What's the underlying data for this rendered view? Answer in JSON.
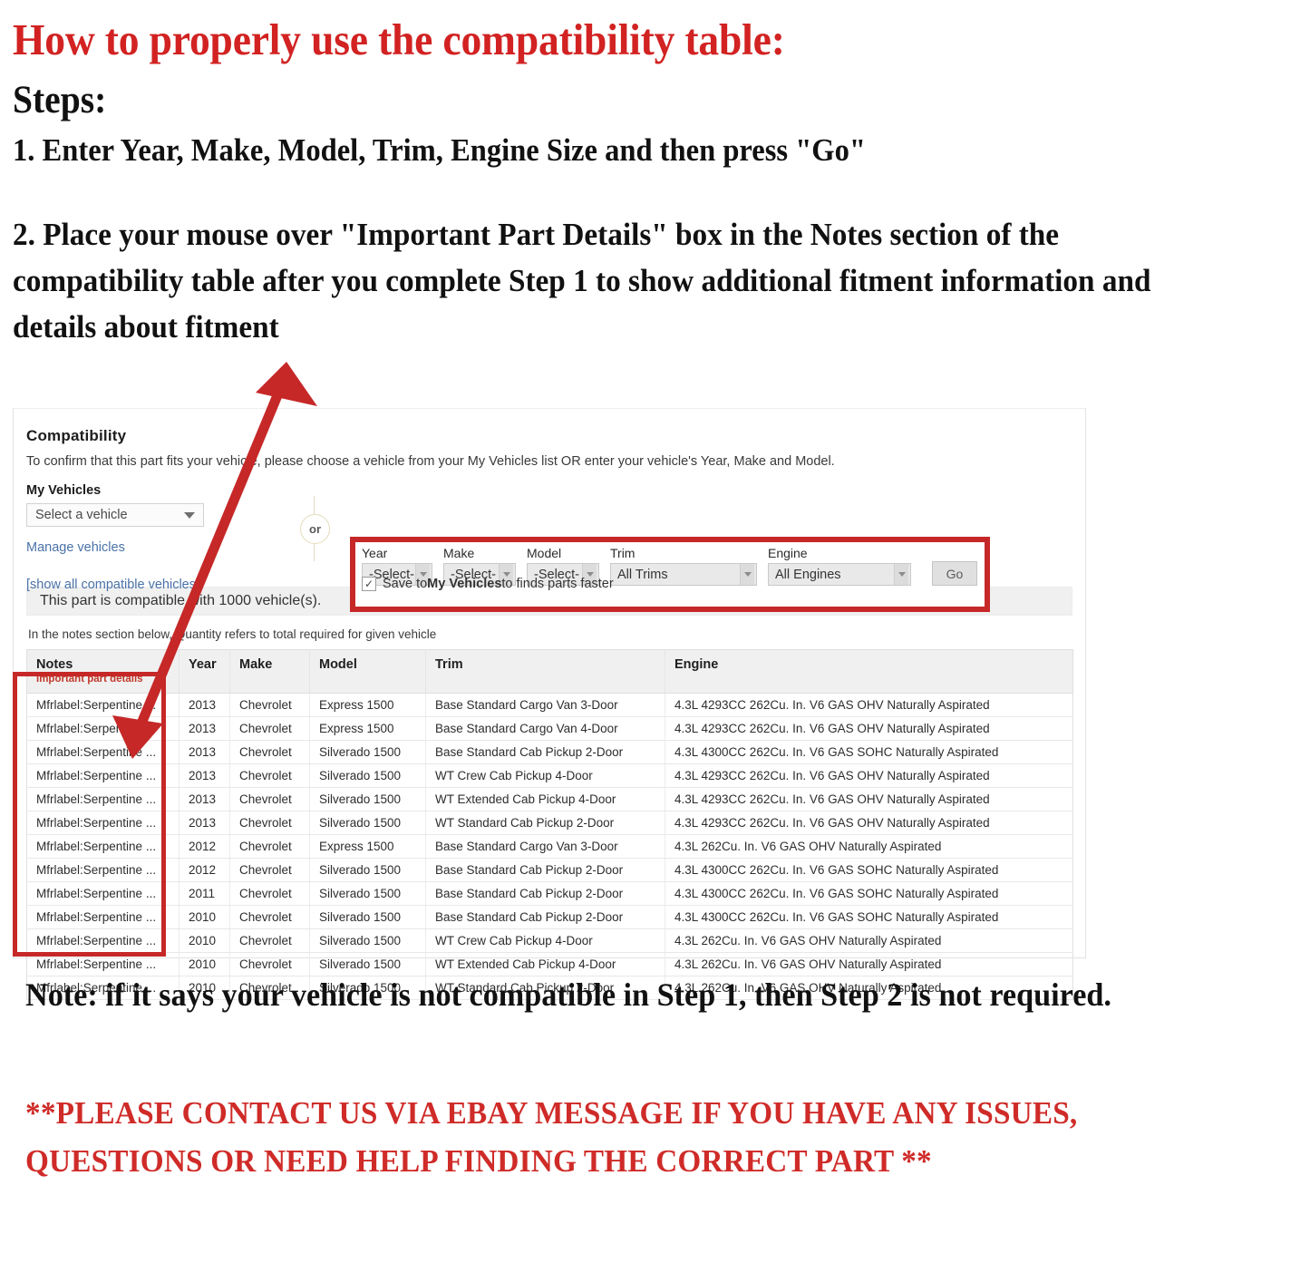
{
  "instructions": {
    "title": "How to properly use the compatibility table:",
    "steps_label": "Steps:",
    "step1": "1. Enter Year, Make, Model, Trim, Engine Size and then press \"Go\"",
    "step2": "2. Place your mouse over \"Important Part Details\" box in the Notes section of the compatibility table after you complete Step 1 to show additional fitment information and details about fitment"
  },
  "panel": {
    "heading": "Compatibility",
    "subheading": "To confirm that this part fits your vehicle, please choose a vehicle from your My Vehicles list OR enter your vehicle's Year, Make and Model.",
    "my_vehicles_label": "My Vehicles",
    "vehicle_select_value": "Select a vehicle",
    "manage_vehicles_link": "Manage vehicles",
    "show_all_link": "[show all compatible vehicles]",
    "or_label": "or",
    "fields": [
      {
        "label": "Year",
        "value": "-Select-"
      },
      {
        "label": "Make",
        "value": "-Select-"
      },
      {
        "label": "Model",
        "value": "-Select-"
      },
      {
        "label": "Trim",
        "value": "All Trims"
      },
      {
        "label": "Engine",
        "value": "All Engines"
      }
    ],
    "go_label": "Go",
    "save_checkbox_checked": "✓",
    "save_text_pre": "Save to ",
    "save_text_bold": "My Vehicles",
    "save_text_post": " to finds parts faster",
    "compat_count_text": "This part is compatible with 1000 vehicle(s).",
    "notes_hint": "In the notes section below, Quantity refers to total required for given vehicle"
  },
  "table": {
    "columns": [
      "Notes",
      "Year",
      "Make",
      "Model",
      "Trim",
      "Engine"
    ],
    "notes_subheader": "Important part details",
    "rows": [
      [
        "Mfrlabel:Serpentine ...",
        "2013",
        "Chevrolet",
        "Express 1500",
        "Base Standard Cargo Van 3-Door",
        "4.3L 4293CC 262Cu. In. V6 GAS OHV Naturally Aspirated"
      ],
      [
        "Mfrlabel:Serpentine ...",
        "2013",
        "Chevrolet",
        "Express 1500",
        "Base Standard Cargo Van 4-Door",
        "4.3L 4293CC 262Cu. In. V6 GAS OHV Naturally Aspirated"
      ],
      [
        "Mfrlabel:Serpentine ...",
        "2013",
        "Chevrolet",
        "Silverado 1500",
        "Base Standard Cab Pickup 2-Door",
        "4.3L 4300CC 262Cu. In. V6 GAS SOHC Naturally Aspirated"
      ],
      [
        "Mfrlabel:Serpentine ...",
        "2013",
        "Chevrolet",
        "Silverado 1500",
        "WT Crew Cab Pickup 4-Door",
        "4.3L 4293CC 262Cu. In. V6 GAS OHV Naturally Aspirated"
      ],
      [
        "Mfrlabel:Serpentine ...",
        "2013",
        "Chevrolet",
        "Silverado 1500",
        "WT Extended Cab Pickup 4-Door",
        "4.3L 4293CC 262Cu. In. V6 GAS OHV Naturally Aspirated"
      ],
      [
        "Mfrlabel:Serpentine ...",
        "2013",
        "Chevrolet",
        "Silverado 1500",
        "WT Standard Cab Pickup 2-Door",
        "4.3L 4293CC 262Cu. In. V6 GAS OHV Naturally Aspirated"
      ],
      [
        "Mfrlabel:Serpentine ...",
        "2012",
        "Chevrolet",
        "Express 1500",
        "Base Standard Cargo Van 3-Door",
        "4.3L 262Cu. In. V6 GAS OHV Naturally Aspirated"
      ],
      [
        "Mfrlabel:Serpentine ...",
        "2012",
        "Chevrolet",
        "Silverado 1500",
        "Base Standard Cab Pickup 2-Door",
        "4.3L 4300CC 262Cu. In. V6 GAS SOHC Naturally Aspirated"
      ],
      [
        "Mfrlabel:Serpentine ...",
        "2011",
        "Chevrolet",
        "Silverado 1500",
        "Base Standard Cab Pickup 2-Door",
        "4.3L 4300CC 262Cu. In. V6 GAS SOHC Naturally Aspirated"
      ],
      [
        "Mfrlabel:Serpentine ...",
        "2010",
        "Chevrolet",
        "Silverado 1500",
        "Base Standard Cab Pickup 2-Door",
        "4.3L 4300CC 262Cu. In. V6 GAS SOHC Naturally Aspirated"
      ],
      [
        "Mfrlabel:Serpentine ...",
        "2010",
        "Chevrolet",
        "Silverado 1500",
        "WT Crew Cab Pickup 4-Door",
        "4.3L 262Cu. In. V6 GAS OHV Naturally Aspirated"
      ],
      [
        "Mfrlabel:Serpentine ...",
        "2010",
        "Chevrolet",
        "Silverado 1500",
        "WT Extended Cab Pickup 4-Door",
        "4.3L 262Cu. In. V6 GAS OHV Naturally Aspirated"
      ],
      [
        "Mfrlabel:Serpentine ...",
        "2010",
        "Chevrolet",
        "Silverado 1500",
        "WT Standard Cab Pickup 2-Door",
        "4.3L 262Cu. In. V6 GAS OHV Naturally Aspirated"
      ]
    ]
  },
  "footer": {
    "note": "Note: if it says your vehicle is not compatible in Step 1, then Step 2 is not required.",
    "contact": "**PLEASE CONTACT US VIA EBAY MESSAGE IF YOU HAVE ANY ISSUES, QUESTIONS OR NEED HELP FINDING THE CORRECT PART **"
  },
  "colors": {
    "title_red": "#d22222",
    "highlight_red": "#c62828",
    "link_blue": "#4a72a8",
    "notes_red": "#c0392b"
  }
}
